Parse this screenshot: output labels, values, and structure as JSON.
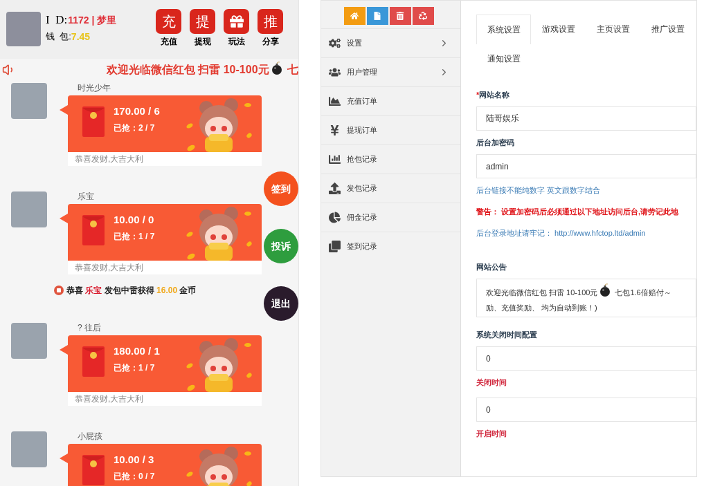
{
  "phone": {
    "header": {
      "id_label": "I  D:",
      "id_value": "1172 | 梦里",
      "wallet_label": "钱  包:",
      "wallet_value": "7.45",
      "actions": [
        {
          "kind": "char",
          "glyph": "充",
          "label": "充值"
        },
        {
          "kind": "char",
          "glyph": "提",
          "label": "提现"
        },
        {
          "kind": "gift",
          "label": "玩法"
        },
        {
          "kind": "char",
          "glyph": "推",
          "label": "分享"
        }
      ]
    },
    "marquee": {
      "text": "欢迎光临微信红包 扫雷 10-100元",
      "bomb": true,
      "tail": "七"
    },
    "messages": [
      {
        "kind": "packet",
        "name": "时光少年",
        "amount": "170.00 / 6",
        "grabbed": "已抢：2 / 7",
        "caption": "恭喜发财,大吉大利"
      },
      {
        "kind": "packet",
        "name": "乐宝",
        "amount": "10.00 / 0",
        "grabbed": "已抢：1 / 7",
        "caption": "恭喜发财,大吉大利"
      },
      {
        "kind": "notice",
        "prefix": "恭喜",
        "user": "乐宝",
        "middle": "发包中雷获得",
        "amount": "16.00",
        "suffix": "金币"
      },
      {
        "kind": "packet",
        "name": "? 往后",
        "amount": "180.00 / 1",
        "grabbed": "已抢：1 / 7",
        "caption": "恭喜发财,大吉大利"
      },
      {
        "kind": "packet",
        "name": "小屁孩",
        "amount": "10.00 / 3",
        "grabbed": "已抢：0 / 7"
      }
    ],
    "side_buttons": [
      {
        "label": "签到",
        "color": "#f4511e"
      },
      {
        "label": "投诉",
        "color": "#2e9d3e"
      },
      {
        "label": "退出",
        "color": "#2a1b2c"
      }
    ]
  },
  "admin": {
    "toolbar": [
      {
        "color": "#f39c12"
      },
      {
        "color": "#3a97d8"
      },
      {
        "color": "#e04b4a"
      },
      {
        "color": "#e04b4a"
      }
    ],
    "menu": [
      {
        "label": "设置",
        "expandable": true
      },
      {
        "label": "用户管理",
        "expandable": true
      },
      {
        "label": "充值订单",
        "expandable": false
      },
      {
        "label": "提现订单",
        "expandable": false
      },
      {
        "label": "抢包记录",
        "expandable": false
      },
      {
        "label": "发包记录",
        "expandable": false
      },
      {
        "label": "佣金记录",
        "expandable": false
      },
      {
        "label": "签到记录",
        "expandable": false
      }
    ],
    "tabs": [
      {
        "label": "系统设置",
        "selected": true
      },
      {
        "label": "游戏设置",
        "selected": false
      },
      {
        "label": "主页设置",
        "selected": false
      },
      {
        "label": "推广设置",
        "selected": false
      },
      {
        "label": "通知设置",
        "selected": false
      }
    ],
    "form": [
      {
        "kind": "input",
        "marker": "*",
        "label": "网站名称",
        "value": "陆哥娱乐"
      },
      {
        "kind": "input",
        "label": "后台加密码",
        "value": "admin"
      },
      {
        "kind": "hint",
        "text": "后台链接不能纯数字 英文跟数字结合"
      },
      {
        "kind": "warning",
        "text": "警告： 设置加密码后必须通过以下地址访问后台,请劳记此地"
      },
      {
        "kind": "hint",
        "text": "后台登录地址请牢记： http://www.hfctop.ltd/admin"
      },
      {
        "kind": "textarea",
        "label": "网站公告",
        "lines": [
          {
            "text": "欢迎光临微信红包 扫雷  10-100元",
            "bomb": true,
            "after": "七包1.6倍赔付～"
          },
          {
            "text": "励、充值奖励、 均为自动到账！)",
            "bomb": false
          }
        ]
      },
      {
        "kind": "input",
        "label": "系统关闭时间配置",
        "value": "0"
      },
      {
        "kind": "alert",
        "text": "关闭时间"
      },
      {
        "kind": "input",
        "value": "0"
      },
      {
        "kind": "alert",
        "text": "开启时间"
      }
    ]
  }
}
